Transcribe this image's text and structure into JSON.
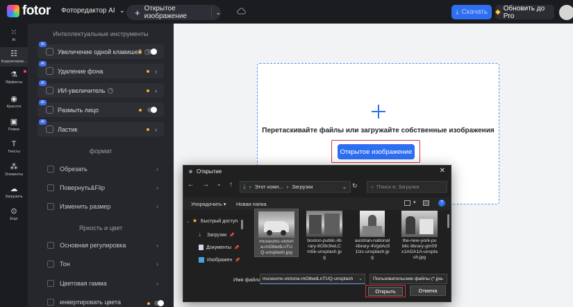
{
  "topbar": {
    "logo": "fotor",
    "editor_menu": "Фоторедактор AI",
    "open_image": "Открытое изображение",
    "save": "Скачать",
    "upgrade": "Обновить до Pro"
  },
  "rail": {
    "items": [
      {
        "label": "AI",
        "icon": "ai-grid-icon"
      },
      {
        "label": "Корректиров...",
        "icon": "sliders-icon"
      },
      {
        "label": "Эффекты",
        "icon": "effects-icon"
      },
      {
        "label": "Красота",
        "icon": "eye-icon"
      },
      {
        "label": "Рамка",
        "icon": "frame-icon"
      },
      {
        "label": "Тексты",
        "icon": "text-icon"
      },
      {
        "label": "Элементы",
        "icon": "elements-icon"
      },
      {
        "label": "Загрузить",
        "icon": "upload-icon"
      },
      {
        "label": "Еще",
        "icon": "more-icon"
      }
    ]
  },
  "panel": {
    "section_ai": "Интеллектуальные инструменты",
    "ai_tools": [
      {
        "label": "Увеличение одной клавишей",
        "badge": "AI"
      },
      {
        "label": "Удаление фона",
        "badge": "AI"
      },
      {
        "label": "ИИ-увеличитель",
        "badge": "AI"
      },
      {
        "label": "Размыть лицо",
        "badge": "AI"
      },
      {
        "label": "Ластик",
        "badge": "AI"
      }
    ],
    "section_format": "формат",
    "format_tools": [
      {
        "label": "Обрезать"
      },
      {
        "label": "Повернуть&Flip"
      },
      {
        "label": "Изменить размер"
      }
    ],
    "section_color": "Яркость и цвет",
    "color_tools": [
      {
        "label": "Основная регулировка"
      },
      {
        "label": "Тон"
      },
      {
        "label": "Цветовая гамма"
      },
      {
        "label": "инвертировать цвета"
      }
    ]
  },
  "dropzone": {
    "text": "Перетаскивайте файлы или загружайте собственные изображения",
    "button": "Открытое изображение"
  },
  "dialog": {
    "title": "Открытие",
    "path": [
      "Этот комп...",
      "Загрузки"
    ],
    "search_placeholder": "Поиск в: Загрузки",
    "organize": "Упорядочить",
    "new_folder": "Новая папка",
    "nav": [
      {
        "label": "Быстрый доступ",
        "icon": "star-icon"
      },
      {
        "label": "Загрузки",
        "icon": "download-icon"
      },
      {
        "label": "Документы",
        "icon": "document-icon"
      },
      {
        "label": "Изображен",
        "icon": "pictures-icon"
      }
    ],
    "files": [
      {
        "name": "museums-victoria-mO8wdLnTUQ-unsplash.jpg",
        "l1": "museums-victori",
        "l2": "a-mO8wdLnTU",
        "l3": "Q-unsplash.jpg",
        "l4": ""
      },
      {
        "name": "boston-public-library-8O9c9wLCm5k-unsplash.jpg",
        "l1": "boston-public-lib",
        "l2": "rary-8O9c9wLC",
        "l3": "m5k-unsplash.jp",
        "l4": "g"
      },
      {
        "name": "austrian-national-library-4VgdAc51Izc-unsplash.jpg",
        "l1": "austrian-national",
        "l2": "-library-4VgdAc5",
        "l3": "1Izc-unsplash.jp",
        "l4": "g"
      },
      {
        "name": "the-new-york-public-library-gm09x1AGA1A-unsplash.jpg",
        "l1": "the-new-york-pu",
        "l2": "blic-library-gm09",
        "l3": "x1AGA1A-unspla",
        "l4": "sh.jpg"
      }
    ],
    "filename_label": "Имя файла:",
    "filename_value": "museums-victoria-mO8wdLnTUQ-unsplash",
    "filetype": "Пользовательские файлы (*.jpe",
    "open": "Открыть",
    "cancel": "Отмена"
  },
  "colors": {
    "accent": "#2e6ff2",
    "highlight_frame": "#d33140",
    "topbar": "#1b1c20",
    "panel": "#26272c"
  }
}
